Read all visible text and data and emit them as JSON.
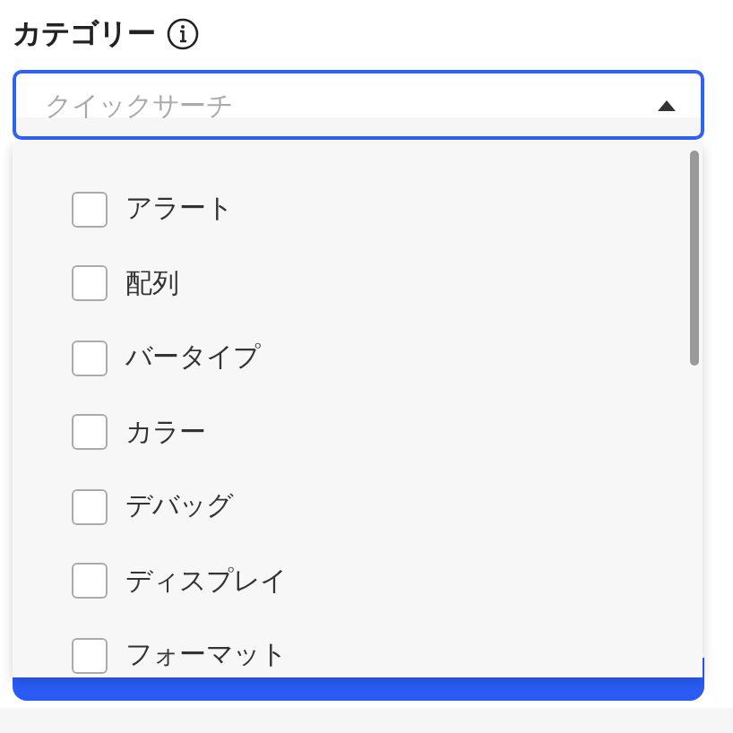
{
  "field": {
    "label": "カテゴリー",
    "placeholder": "クイックサーチ",
    "expanded": true
  },
  "options": [
    {
      "label": "アラート",
      "checked": false
    },
    {
      "label": "配列",
      "checked": false
    },
    {
      "label": "バータイプ",
      "checked": false
    },
    {
      "label": "カラー",
      "checked": false
    },
    {
      "label": "デバッグ",
      "checked": false
    },
    {
      "label": "ディスプレイ",
      "checked": false
    },
    {
      "label": "フォーマット",
      "checked": false
    }
  ]
}
